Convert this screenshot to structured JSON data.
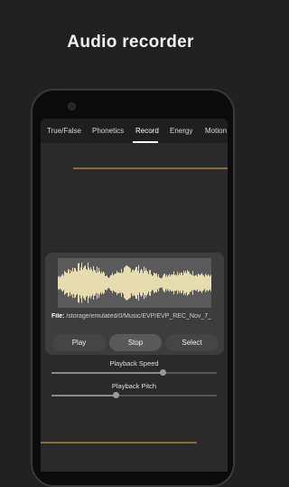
{
  "promo": {
    "title": "Audio recorder"
  },
  "tabs": [
    {
      "label": "True/False"
    },
    {
      "label": "Phonetics"
    },
    {
      "label": "Record"
    },
    {
      "label": "Energy"
    },
    {
      "label": "Motion"
    }
  ],
  "recorder": {
    "file_prefix": "File:",
    "file_path": " /storage/emulated/0/Music/EVP/EVP_REC_Nov_7_",
    "buttons": {
      "play": "Play",
      "stop": "Stop",
      "select": "Select"
    },
    "playback_speed": {
      "label": "Playback Speed",
      "value": 0.67
    },
    "playback_pitch": {
      "label": "Playback Pitch",
      "value": 0.39
    }
  },
  "colors": {
    "accent_line": "#8a6d3b",
    "waveform": "#e6dcb0",
    "waveform_bg": "#5a5a5a"
  }
}
